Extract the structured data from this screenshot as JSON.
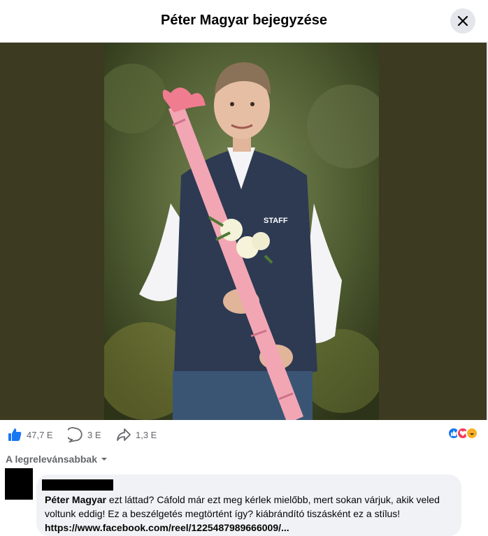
{
  "header": {
    "title": "Péter Magyar bejegyzése"
  },
  "photo": {
    "vest_text": "STAFF"
  },
  "stats": {
    "likes": "47,7 E",
    "comments": "3 E",
    "shares": "1,3 E"
  },
  "sort": {
    "label": "A legrelevánsabbak"
  },
  "comment": {
    "mention": "Péter Magyar",
    "text": " ezt láttad? Cáfold már ezt meg kérlek mielőbb, mert sokan várjuk, akik veled voltunk eddig! Ez a beszélgetés megtörtént így? kiábrándító tiszásként ez a stílus!",
    "link": "https://www.facebook.com/reel/1225487989666009/..."
  },
  "colors": {
    "like_blue": "#1877f2",
    "love_red": "#f33e58",
    "haha_yellow": "#f7b125",
    "backdrop": "#3c3a20"
  }
}
